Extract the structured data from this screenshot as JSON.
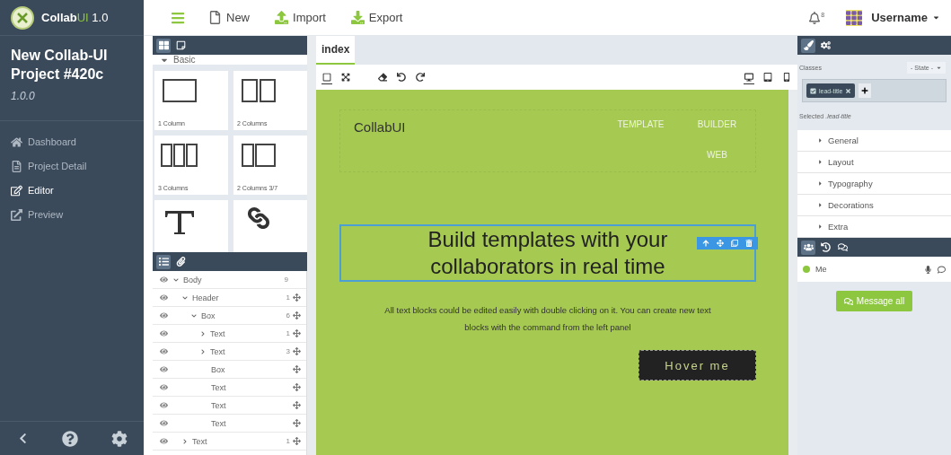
{
  "sidebar": {
    "logo": {
      "name": "Collab",
      "accent": "UI",
      "version": "1.0"
    },
    "project_title": "New Collab-UI Project #420c",
    "project_version": "1.0.0",
    "items": [
      {
        "kind": "home",
        "label": "Dashboard",
        "selected": false
      },
      {
        "kind": "file",
        "label": "Project Detail",
        "selected": false
      },
      {
        "kind": "edit",
        "label": "Editor",
        "selected": true
      },
      {
        "kind": "external",
        "label": "Preview",
        "selected": false
      }
    ]
  },
  "toolbar": {
    "buttons": [
      {
        "kind": "new",
        "label": "New"
      },
      {
        "kind": "import",
        "label": "Import"
      },
      {
        "kind": "export",
        "label": "Export"
      }
    ],
    "notifications": "8",
    "username": "Username"
  },
  "blocks": {
    "tabs": [
      {
        "kind": "blocks",
        "selected": true
      },
      {
        "kind": "pages",
        "selected": false
      }
    ],
    "category": "Basic",
    "expanded": true,
    "items": [
      {
        "kind": "col1",
        "label": "1 Column"
      },
      {
        "kind": "col2",
        "label": "2 Columns"
      },
      {
        "kind": "col3",
        "label": "3 Columns"
      },
      {
        "kind": "col37",
        "label": "2 Columns 3/7"
      },
      {
        "kind": "text"
      },
      {
        "kind": "link"
      }
    ]
  },
  "layers": {
    "tabs": [
      {
        "kind": "layers",
        "selected": true
      },
      {
        "kind": "assets",
        "selected": false
      }
    ],
    "tree": [
      {
        "name": "Body",
        "count": "9",
        "expanded": true,
        "movable": false,
        "children": [
          {
            "name": "Header",
            "count": "1",
            "expanded": true,
            "movable": true,
            "children": [
              {
                "name": "Box",
                "count": "6",
                "expanded": true,
                "movable": true,
                "children": [
                  {
                    "name": "Text",
                    "count": "1",
                    "expanded": false,
                    "movable": true
                  },
                  {
                    "name": "Text",
                    "count": "3",
                    "expanded": false,
                    "movable": true
                  },
                  {
                    "name": "Box",
                    "movable": true
                  },
                  {
                    "name": "Text",
                    "movable": true
                  },
                  {
                    "name": "Text",
                    "movable": true
                  },
                  {
                    "name": "Text",
                    "movable": true
                  }
                ]
              }
            ]
          },
          {
            "name": "Text",
            "count": "1",
            "expanded": false,
            "movable": true
          }
        ]
      }
    ]
  },
  "editor": {
    "tabs": [
      {
        "label": "index",
        "selected": true
      }
    ],
    "tools": [
      {
        "kind": "outline",
        "selected": true
      },
      {
        "kind": "fullscreen",
        "selected": false
      },
      {
        "kind": "eraser",
        "selected": false
      },
      {
        "kind": "undo",
        "selected": false
      },
      {
        "kind": "redo",
        "selected": false
      }
    ],
    "devices": [
      {
        "kind": "desktop",
        "selected": true
      },
      {
        "kind": "tablet",
        "selected": false
      },
      {
        "kind": "mobile",
        "selected": false
      }
    ],
    "canvas": {
      "brand": "CollabUI",
      "nav": [
        "TEMPLATE",
        "BUILDER",
        "WEB"
      ],
      "heading": "Build templates with your collaborators in real time",
      "heading_selected": true,
      "paragraph": "All text blocks could be edited easily with double clicking on it. You can create new text blocks with the command from the left panel",
      "button": "Hover me"
    }
  },
  "style_panel": {
    "tabs": [
      {
        "kind": "style",
        "selected": true
      },
      {
        "kind": "settings",
        "selected": false
      }
    ],
    "classes_label": "Classes",
    "state": "- State -",
    "tags": [
      {
        "label": "lead-title",
        "checked": true
      }
    ],
    "selected_label": "Selected",
    "selected_value": ".lead-title",
    "sectors": [
      {
        "label": "General",
        "expanded": false
      },
      {
        "label": "Layout",
        "expanded": false
      },
      {
        "label": "Typography",
        "expanded": false
      },
      {
        "label": "Decorations",
        "expanded": false
      },
      {
        "label": "Extra",
        "expanded": false
      }
    ]
  },
  "collab_panel": {
    "tabs": [
      {
        "kind": "users",
        "selected": true
      },
      {
        "kind": "history",
        "selected": false
      },
      {
        "kind": "chat",
        "selected": false
      }
    ],
    "users": [
      {
        "name": "Me",
        "color": "#8dc63f"
      }
    ],
    "message_button": "Message all"
  }
}
